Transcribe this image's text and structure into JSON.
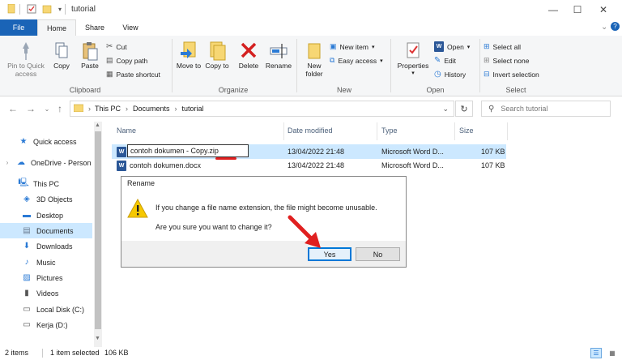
{
  "window": {
    "title": "tutorial",
    "controls": {
      "minimize": "—",
      "maximize": "☐",
      "close": "✕"
    }
  },
  "tabs": {
    "file": "File",
    "home": "Home",
    "share": "Share",
    "view": "View"
  },
  "ribbon": {
    "clipboard": {
      "label": "Clipboard",
      "pin": "Pin to Quick access",
      "copy": "Copy",
      "paste": "Paste",
      "cut": "Cut",
      "copy_path": "Copy path",
      "paste_shortcut": "Paste shortcut"
    },
    "organize": {
      "label": "Organize",
      "move_to": "Move to",
      "copy_to": "Copy to",
      "delete": "Delete",
      "rename": "Rename"
    },
    "new": {
      "label": "New",
      "new_folder": "New folder",
      "new_item": "New item",
      "easy_access": "Easy access"
    },
    "open": {
      "label": "Open",
      "properties": "Properties",
      "open": "Open",
      "edit": "Edit",
      "history": "History"
    },
    "select": {
      "label": "Select",
      "select_all": "Select all",
      "select_none": "Select none",
      "invert_selection": "Invert selection"
    }
  },
  "address": {
    "crumbs": [
      "This PC",
      "Documents",
      "tutorial"
    ],
    "search_placeholder": "Search tutorial"
  },
  "nav_pane": {
    "items": [
      {
        "label": "Quick access",
        "icon": "star-icon"
      },
      {
        "label": "OneDrive - Person",
        "icon": "cloud-icon"
      },
      {
        "label": "This PC",
        "icon": "computer-icon"
      },
      {
        "label": "3D Objects",
        "icon": "cube-icon"
      },
      {
        "label": "Desktop",
        "icon": "desktop-icon"
      },
      {
        "label": "Documents",
        "icon": "documents-icon"
      },
      {
        "label": "Downloads",
        "icon": "download-icon"
      },
      {
        "label": "Music",
        "icon": "music-icon"
      },
      {
        "label": "Pictures",
        "icon": "pictures-icon"
      },
      {
        "label": "Videos",
        "icon": "videos-icon"
      },
      {
        "label": "Local Disk (C:)",
        "icon": "disk-icon"
      },
      {
        "label": "Kerja (D:)",
        "icon": "disk-icon"
      }
    ]
  },
  "file_list": {
    "columns": {
      "name": "Name",
      "date": "Date modified",
      "type": "Type",
      "size": "Size"
    },
    "rows": [
      {
        "name": "contoh dokumen - Copy.zip",
        "date": "13/04/2022 21:48",
        "type": "Microsoft Word D...",
        "size": "107 KB"
      },
      {
        "name": "contoh dokumen.docx",
        "date": "13/04/2022 21:48",
        "type": "Microsoft Word D...",
        "size": "107 KB"
      }
    ]
  },
  "dialog": {
    "title": "Rename",
    "message": "If you change a file name extension, the file might become unusable.",
    "question": "Are you sure you want to change it?",
    "yes": "Yes",
    "no": "No"
  },
  "status": {
    "items": "2 items",
    "selected": "1 item selected",
    "size": "106 KB"
  },
  "colors": {
    "accent": "#1a64b7",
    "selection": "#cce8ff",
    "annotation": "#e02020"
  }
}
